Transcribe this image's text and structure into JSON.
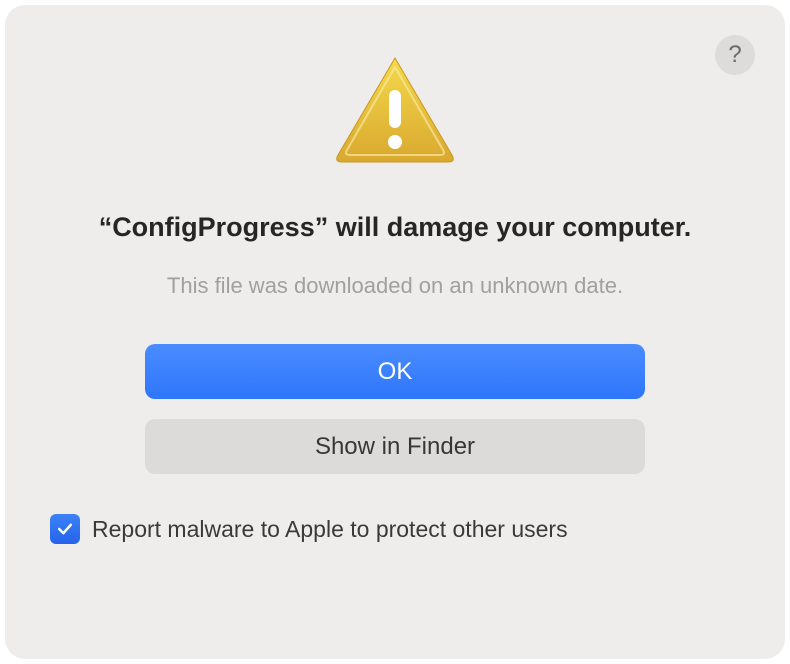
{
  "dialog": {
    "title": "“ConfigProgress” will damage your computer.",
    "subtitle": "This file was downloaded on an unknown date.",
    "help_symbol": "?",
    "buttons": {
      "ok": "OK",
      "show_in_finder": "Show in Finder"
    },
    "checkbox": {
      "checked": true,
      "label": "Report malware to Apple to protect other users"
    }
  }
}
